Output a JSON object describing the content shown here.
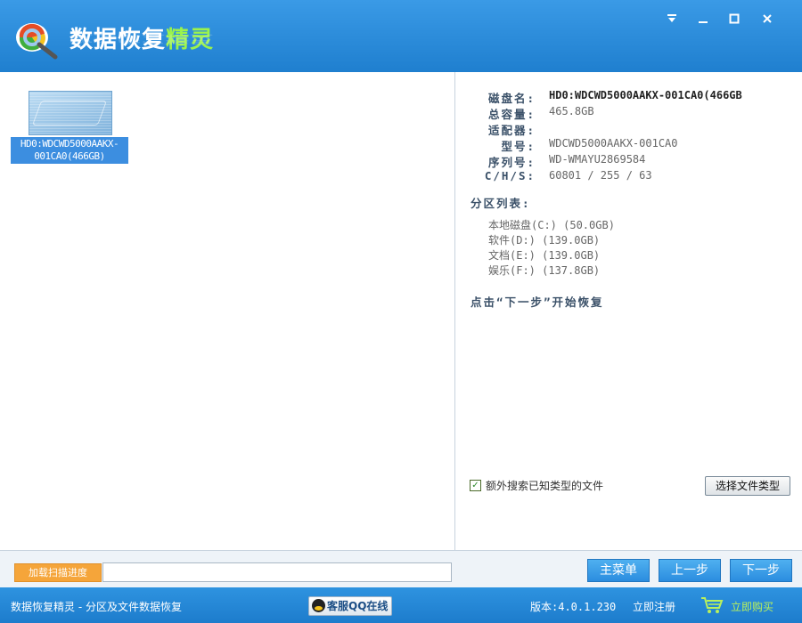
{
  "app": {
    "title_main": "数据恢复",
    "title_highlight": "精灵",
    "window_controls": [
      "dropdown-icon",
      "minimize-icon",
      "maximize-icon",
      "close-icon"
    ]
  },
  "disk": {
    "label": "HD0:WDCWD5000AAKX-001CA0(466GB)"
  },
  "info": {
    "disk_name_label": "磁盘名:",
    "disk_name_value": "HD0:WDCWD5000AAKX-001CA0(466GB",
    "capacity_label": "总容量:",
    "capacity_value": "465.8GB",
    "adapter_label": "适配器:",
    "model_label": "型号:",
    "model_value": "WDCWD5000AAKX-001CA0",
    "serial_label": "序列号:",
    "serial_value": "WD-WMAYU2869584",
    "chs_label": "C/H/S:",
    "chs_value": "60801 / 255 / 63"
  },
  "partitions": {
    "title": "分区列表:",
    "items": [
      "本地磁盘(C:) (50.0GB)",
      "软件(D:) (139.0GB)",
      "文档(E:) (139.0GB)",
      "娱乐(F:) (137.8GB)"
    ]
  },
  "hint": "点击“下一步”开始恢复",
  "options": {
    "extra_search_label": "额外搜索已知类型的文件",
    "extra_search_checked": true,
    "file_type_button": "选择文件类型"
  },
  "bottom": {
    "load_progress_button": "加载扫描进度",
    "main_menu_button": "主菜单",
    "prev_button": "上一步",
    "next_button": "下一步"
  },
  "status": {
    "left_text": "数据恢复精灵 - 分区及文件数据恢复",
    "qq_button": "客服QQ在线",
    "version": "版本:4.0.1.230",
    "register": "立即注册",
    "buy": "立即购买"
  },
  "colors": {
    "titlebar": "#2b8ddf",
    "accent_green": "#9bf34c",
    "button_blue": "#2b8ddf",
    "progress_orange": "#f5a53a",
    "selection_blue": "#3c8ee0"
  }
}
